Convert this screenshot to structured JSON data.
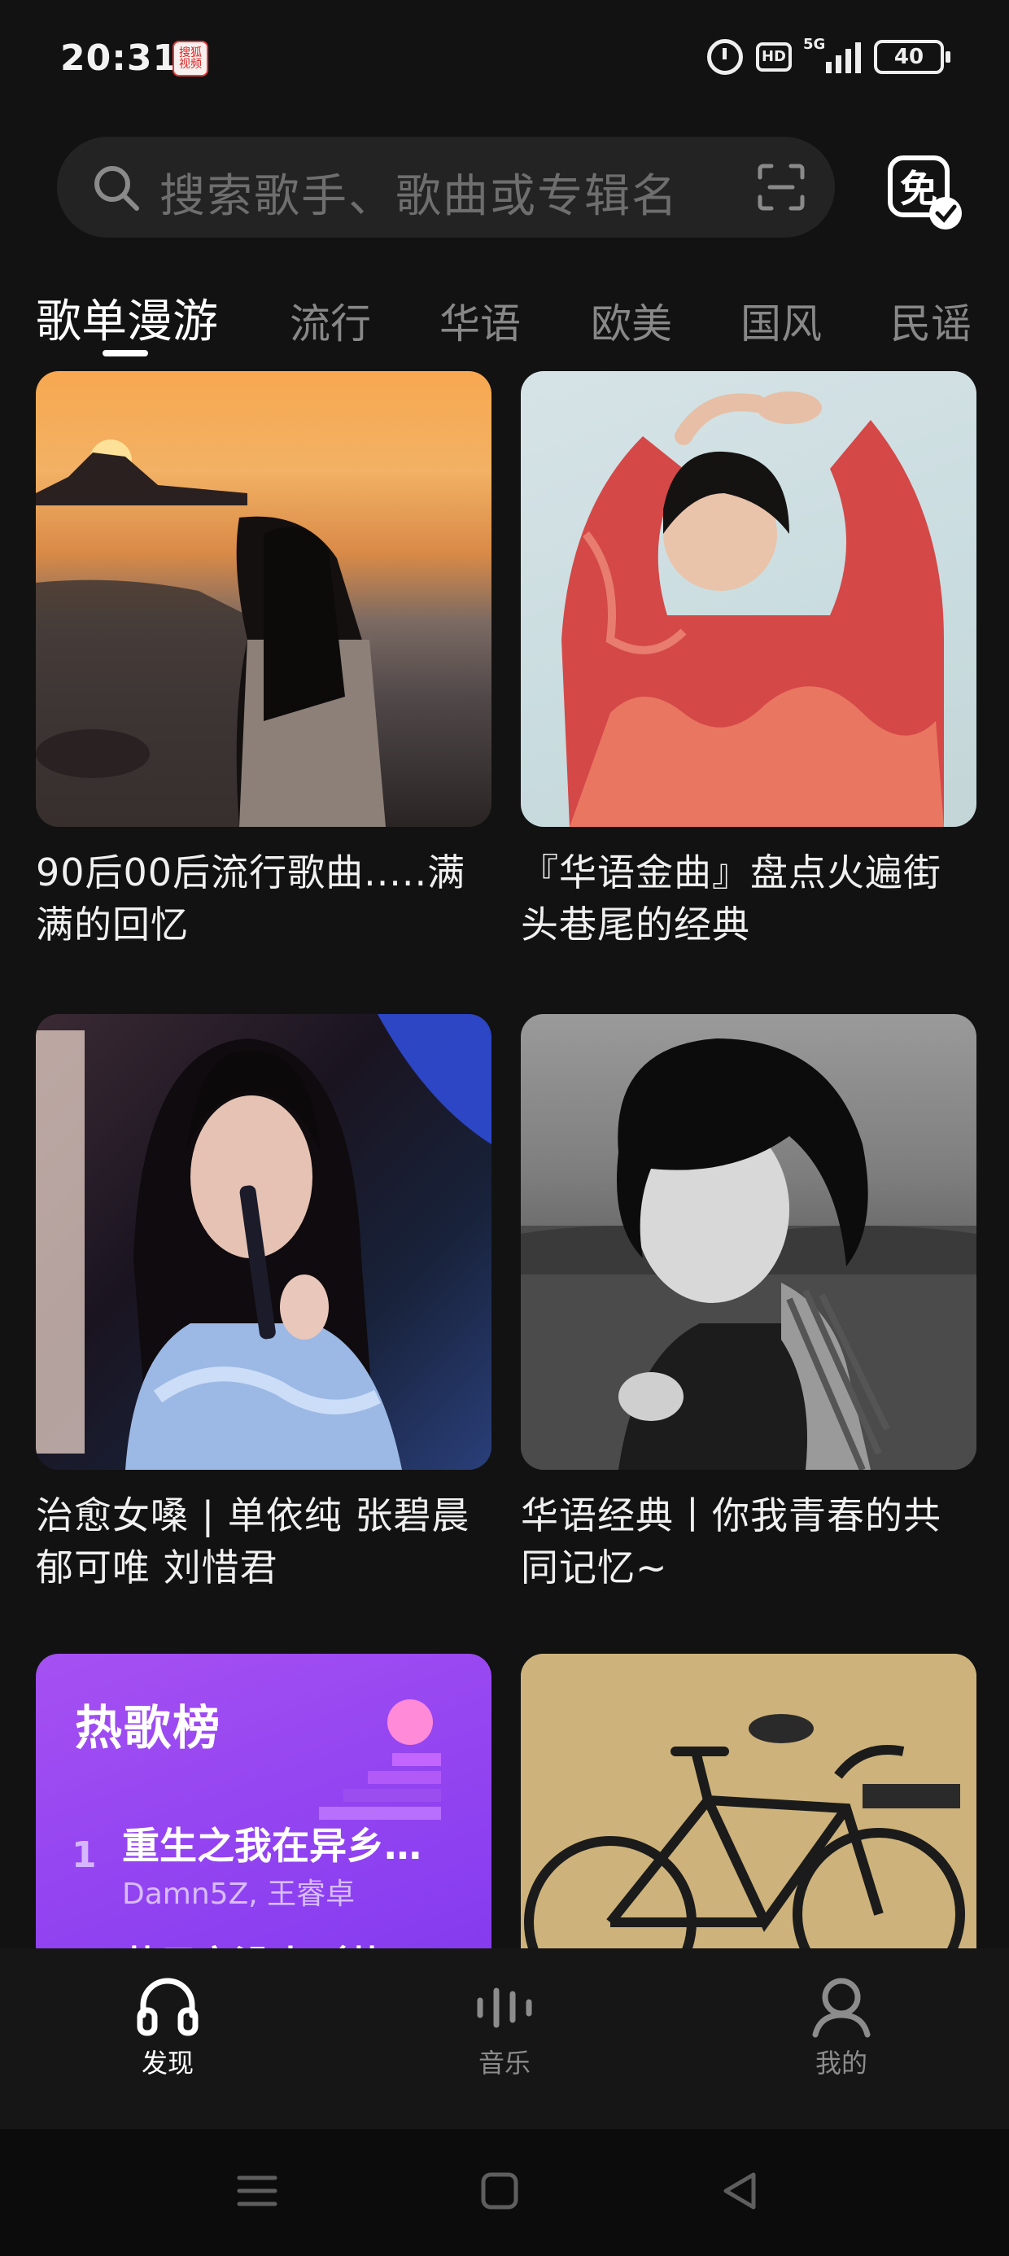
{
  "status_bar": {
    "time": "20:31",
    "app_badge": "搜狐\n视频",
    "hd": "HD",
    "network": "5G",
    "battery": "40"
  },
  "search": {
    "placeholder": "搜索歌手、歌曲或专辑名"
  },
  "free_badge": "免",
  "tabs": [
    {
      "label": "歌单漫游",
      "active": true
    },
    {
      "label": "流行"
    },
    {
      "label": "华语"
    },
    {
      "label": "欧美"
    },
    {
      "label": "国风"
    },
    {
      "label": "民谣"
    }
  ],
  "playlists": [
    {
      "title": "90后00后流行歌曲.....满满的回忆"
    },
    {
      "title": "『华语金曲』盘点火遍街头巷尾的经典"
    },
    {
      "title": "治愈女嗓 | 单依纯  张碧晨  郁可唯  刘惜君"
    },
    {
      "title": "华语经典丨你我青春的共同记忆~"
    }
  ],
  "hot_chart": {
    "title": "热歌榜",
    "rank": "1",
    "song": "重生之我在异乡…",
    "artist": "Damn5Z, 王睿卓",
    "next_song": "若只京没来（若"
  },
  "bottom_nav": [
    {
      "label": "发现",
      "active": true,
      "icon": "headphones-icon"
    },
    {
      "label": "音乐",
      "icon": "equalizer-icon"
    },
    {
      "label": "我的",
      "icon": "user-icon"
    }
  ],
  "colors": {
    "background": "#121212",
    "accent_purple": "#8b3ff0",
    "tab_inactive": "#888888"
  }
}
